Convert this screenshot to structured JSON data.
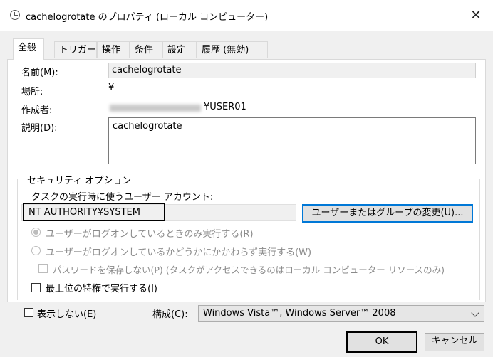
{
  "window": {
    "title": "cachelogrotate のプロパティ (ローカル コンピューター)",
    "close_glyph": "✕"
  },
  "tabs": [
    "全般",
    "トリガー",
    "操作",
    "条件",
    "設定",
    "履歴 (無効)"
  ],
  "general": {
    "name_label": "名前(M):",
    "name_value": "cachelogrotate",
    "location_label": "場所:",
    "location_value": "¥",
    "author_label": "作成者:",
    "author_suffix": "¥USER01",
    "description_label": "説明(D):",
    "description_value": "cachelogrotate"
  },
  "security": {
    "group_label": "セキュリティ オプション",
    "account_label": "タスクの実行時に使うユーザー アカウント:",
    "account_value": "NT AUTHORITY¥SYSTEM",
    "change_button": "ユーザーまたはグループの変更(U)...",
    "radio_logged_on": "ユーザーがログオンしているときのみ実行する(R)",
    "radio_whether": "ユーザーがログオンしているかどうかにかかわらず実行する(W)",
    "no_store_password": "パスワードを保存しない(P) (タスクがアクセスできるのはローカル コンピューター リソースのみ)",
    "highest_privileges": "最上位の特権で実行する(I)"
  },
  "bottom": {
    "hidden_label": "表示しない(E)",
    "configure_label": "構成(C):",
    "configure_value": "Windows Vista™, Windows Server™ 2008",
    "ok_button": "OK",
    "cancel_button": "キャンセル"
  }
}
